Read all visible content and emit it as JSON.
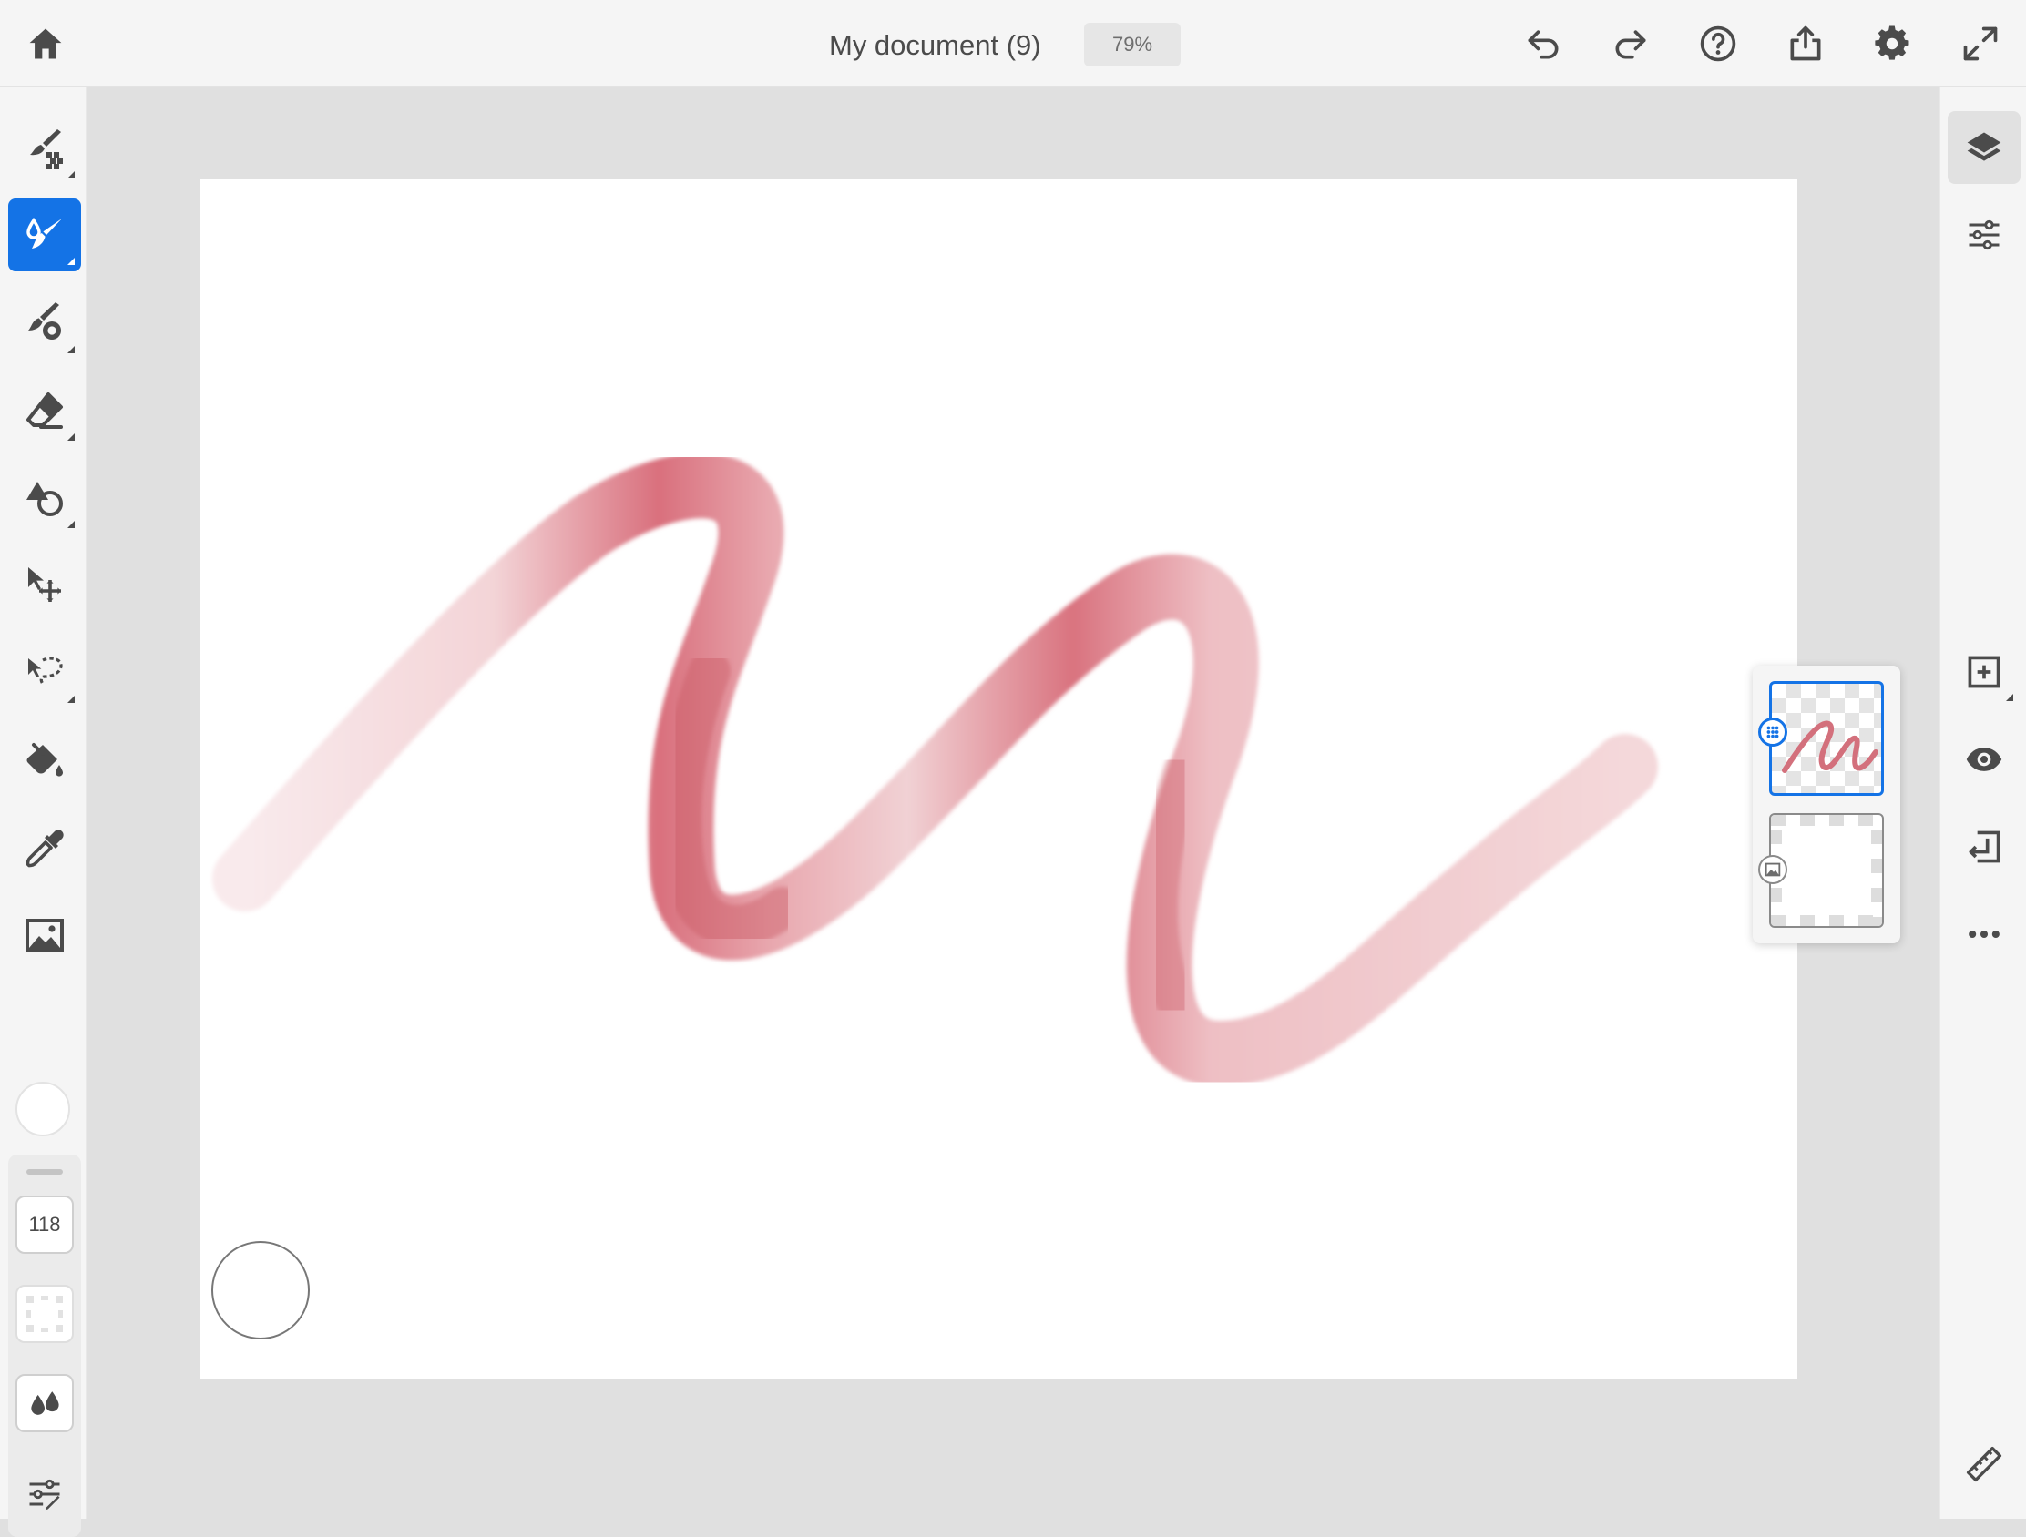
{
  "header": {
    "document_title": "My document (9)",
    "zoom_label": "79%"
  },
  "tools": [
    {
      "name": "pixel-brush",
      "icon": "pixel-brush-icon",
      "active": false
    },
    {
      "name": "live-brush",
      "icon": "live-brush-icon",
      "active": true
    },
    {
      "name": "vector-brush",
      "icon": "vector-brush-icon",
      "active": false
    },
    {
      "name": "eraser",
      "icon": "eraser-icon",
      "active": false
    },
    {
      "name": "shapes",
      "icon": "shapes-icon",
      "active": false
    },
    {
      "name": "transform",
      "icon": "transform-icon",
      "active": false
    },
    {
      "name": "lasso-select",
      "icon": "lasso-icon",
      "active": false
    },
    {
      "name": "fill",
      "icon": "paint-bucket-icon",
      "active": false
    },
    {
      "name": "eyedropper",
      "icon": "eyedropper-icon",
      "active": false
    },
    {
      "name": "image",
      "icon": "image-icon",
      "active": false
    }
  ],
  "current_color": "#ffffff",
  "brush_settings": {
    "size_value": "118"
  },
  "layers": [
    {
      "name": "live-brush-layer",
      "selected": true,
      "badge_icon": "watercolor-badge-icon"
    },
    {
      "name": "background-layer",
      "selected": false,
      "badge_icon": "image-badge-icon"
    }
  ],
  "colors": {
    "accent": "#1473e6",
    "stroke": "#d1626f",
    "toolbar_bg": "#f5f5f5",
    "workspace_bg": "#e0e0e0",
    "icon": "#4b4b4b"
  }
}
